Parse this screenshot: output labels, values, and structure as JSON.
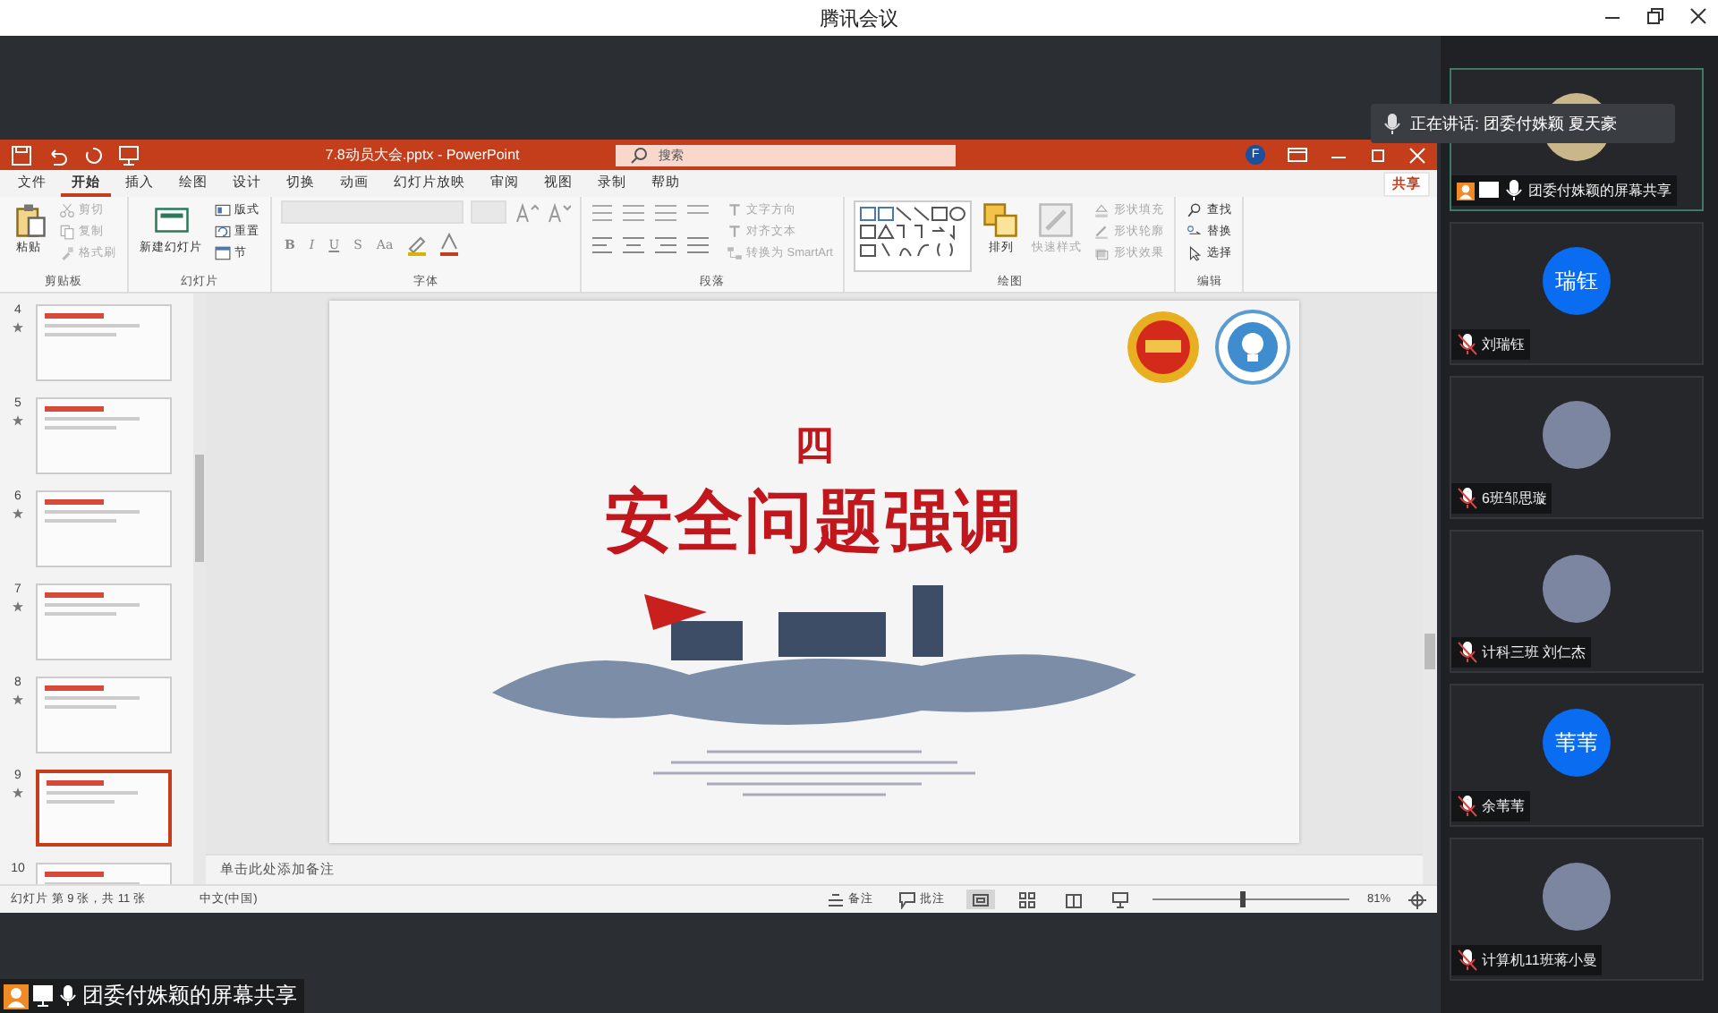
{
  "window": {
    "title": "腾讯会议"
  },
  "speaking_tooltip": "正在讲话: 团委付姝颖  夏天豪",
  "share_label": "团委付姝颖的屏幕共享",
  "powerpoint": {
    "title": "7.8动员大会.pptx - PowerPoint",
    "search": {
      "placeholder": "搜索"
    },
    "account_initial": "F",
    "tabs": [
      {
        "label": "文件",
        "selected": false
      },
      {
        "label": "开始",
        "selected": true
      },
      {
        "label": "插入",
        "selected": false
      },
      {
        "label": "绘图",
        "selected": false
      },
      {
        "label": "设计",
        "selected": false
      },
      {
        "label": "切换",
        "selected": false
      },
      {
        "label": "动画",
        "selected": false
      },
      {
        "label": "幻灯片放映",
        "selected": false
      },
      {
        "label": "审阅",
        "selected": false
      },
      {
        "label": "视图",
        "selected": false
      },
      {
        "label": "录制",
        "selected": false
      },
      {
        "label": "帮助",
        "selected": false
      }
    ],
    "share_button": "共享",
    "ribbon_groups": [
      {
        "label": "剪贴板",
        "kind": "buttons",
        "items": [
          {
            "kind": "large",
            "label": "粘贴",
            "disabled": false
          },
          {
            "kind": "small",
            "label": "剪切",
            "disabled": true
          },
          {
            "kind": "small",
            "label": "复制",
            "disabled": true
          },
          {
            "kind": "small",
            "label": "格式刷",
            "disabled": true
          }
        ]
      },
      {
        "label": "幻灯片",
        "kind": "buttons",
        "items": [
          {
            "kind": "large",
            "label": "新建幻灯片",
            "disabled": false
          },
          {
            "kind": "small",
            "label": "版式",
            "disabled": false
          },
          {
            "kind": "small",
            "label": "重置",
            "disabled": false
          },
          {
            "kind": "small",
            "label": "节",
            "disabled": false
          }
        ]
      },
      {
        "label": "字体",
        "kind": "font",
        "glyphs": [
          "B",
          "I",
          "U",
          "S",
          "Aa"
        ]
      },
      {
        "label": "段落",
        "kind": "paragraph",
        "items": [
          {
            "kind": "small",
            "label": "文字方向",
            "disabled": true
          },
          {
            "kind": "small",
            "label": "对齐文本",
            "disabled": true
          },
          {
            "kind": "small",
            "label": "转换为 SmartArt",
            "disabled": true
          }
        ]
      },
      {
        "label": "绘图",
        "kind": "drawing",
        "items": [
          {
            "kind": "large",
            "label": "排列",
            "disabled": false
          },
          {
            "kind": "large",
            "label": "快速样式",
            "disabled": true
          },
          {
            "kind": "small",
            "label": "形状填充",
            "disabled": true
          },
          {
            "kind": "small",
            "label": "形状轮廓",
            "disabled": true
          },
          {
            "kind": "small",
            "label": "形状效果",
            "disabled": true
          }
        ]
      },
      {
        "label": "编辑",
        "kind": "buttons",
        "items": [
          {
            "kind": "small",
            "label": "查找",
            "disabled": false
          },
          {
            "kind": "small",
            "label": "替换",
            "disabled": false
          },
          {
            "kind": "small",
            "label": "选择",
            "disabled": false
          }
        ]
      }
    ],
    "thumbnails": [
      {
        "number": "4",
        "animated": true,
        "selected": false
      },
      {
        "number": "5",
        "animated": true,
        "selected": false
      },
      {
        "number": "6",
        "animated": true,
        "selected": false
      },
      {
        "number": "7",
        "animated": true,
        "selected": false
      },
      {
        "number": "8",
        "animated": true,
        "selected": false
      },
      {
        "number": "9",
        "animated": true,
        "selected": true
      },
      {
        "number": "10",
        "animated": false,
        "selected": false
      }
    ],
    "slide": {
      "number_heading": "四",
      "title": "安全问题强调"
    },
    "notes_placeholder": "单击此处添加备注",
    "status_bar": {
      "slide_info": "幻灯片 第 9 张，共 11 张",
      "language": "中文(中国)",
      "notes_button": "备注",
      "comments_button": "批注",
      "views": [
        {
          "selected": true
        },
        {
          "selected": false
        },
        {
          "selected": false
        },
        {
          "selected": false
        }
      ],
      "zoom": {
        "level": 0.45,
        "reading": "81%"
      }
    }
  },
  "participants": [
    {
      "name": "团委付姝颖的屏幕共享",
      "kind": "screen",
      "active": true
    },
    {
      "name": "刘瑞钰",
      "kind": "initials",
      "avatar_text": "瑞钰",
      "active": false
    },
    {
      "name": "6班邹思璇",
      "kind": "photo",
      "active": false
    },
    {
      "name": "计科三班 刘仁杰",
      "kind": "photo",
      "active": false
    },
    {
      "name": "余苇苇",
      "kind": "initials",
      "avatar_text": "苇苇",
      "active": false
    },
    {
      "name": "计算机11班蒋小曼",
      "kind": "photo",
      "active": false
    }
  ]
}
